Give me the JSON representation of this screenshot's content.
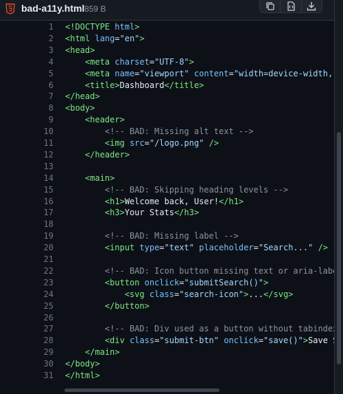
{
  "file": {
    "name": "bad-a11y.html",
    "size": "859 B",
    "icon": "html5-icon"
  },
  "actions": [
    {
      "name": "copy-button",
      "icon": "copy-icon"
    },
    {
      "name": "raw-button",
      "icon": "file-code-icon"
    },
    {
      "name": "download-button",
      "icon": "download-icon"
    }
  ],
  "colors": {
    "tag": "#7ee787",
    "attribute": "#79c0ff",
    "string": "#a5d6ff",
    "comment": "#8b949e",
    "text": "#e6edf3",
    "html5_icon": "#e34c26"
  },
  "code_lines": [
    {
      "n": "1",
      "indent": "",
      "tokens": [
        [
          "tag",
          "<!DOCTYPE"
        ],
        [
          "txt",
          " "
        ],
        [
          "attr",
          "html"
        ],
        [
          "tag",
          ">"
        ]
      ]
    },
    {
      "n": "2",
      "indent": "",
      "tokens": [
        [
          "tag",
          "<html"
        ],
        [
          "txt",
          " "
        ],
        [
          "attr",
          "lang"
        ],
        [
          "txt",
          "="
        ],
        [
          "str",
          "\"en\""
        ],
        [
          "tag",
          ">"
        ]
      ]
    },
    {
      "n": "3",
      "indent": "",
      "tokens": [
        [
          "tag",
          "<head>"
        ]
      ]
    },
    {
      "n": "4",
      "indent": "    ",
      "tokens": [
        [
          "tag",
          "<meta"
        ],
        [
          "txt",
          " "
        ],
        [
          "attr",
          "charset"
        ],
        [
          "txt",
          "="
        ],
        [
          "str",
          "\"UTF-8\""
        ],
        [
          "tag",
          ">"
        ]
      ]
    },
    {
      "n": "5",
      "indent": "    ",
      "tokens": [
        [
          "tag",
          "<meta"
        ],
        [
          "txt",
          " "
        ],
        [
          "attr",
          "name"
        ],
        [
          "txt",
          "="
        ],
        [
          "str",
          "\"viewport\""
        ],
        [
          "txt",
          " "
        ],
        [
          "attr",
          "content"
        ],
        [
          "txt",
          "="
        ],
        [
          "str",
          "\"width=device-width, i"
        ]
      ]
    },
    {
      "n": "6",
      "indent": "    ",
      "tokens": [
        [
          "tag",
          "<title>"
        ],
        [
          "txt",
          "Dashboard"
        ],
        [
          "tag",
          "</title>"
        ]
      ]
    },
    {
      "n": "7",
      "indent": "",
      "tokens": [
        [
          "tag",
          "</head>"
        ]
      ]
    },
    {
      "n": "8",
      "indent": "",
      "tokens": [
        [
          "tag",
          "<body>"
        ]
      ]
    },
    {
      "n": "9",
      "indent": "    ",
      "tokens": [
        [
          "tag",
          "<header>"
        ]
      ]
    },
    {
      "n": "10",
      "indent": "        ",
      "tokens": [
        [
          "com",
          "<!-- BAD: Missing alt text -->"
        ]
      ]
    },
    {
      "n": "11",
      "indent": "        ",
      "tokens": [
        [
          "tag",
          "<img"
        ],
        [
          "txt",
          " "
        ],
        [
          "attr",
          "src"
        ],
        [
          "txt",
          "="
        ],
        [
          "str",
          "\"/logo.png\""
        ],
        [
          "txt",
          " "
        ],
        [
          "tag",
          "/>"
        ]
      ]
    },
    {
      "n": "12",
      "indent": "    ",
      "tokens": [
        [
          "tag",
          "</header>"
        ]
      ]
    },
    {
      "n": "13",
      "indent": "",
      "tokens": []
    },
    {
      "n": "14",
      "indent": "    ",
      "tokens": [
        [
          "tag",
          "<main>"
        ]
      ]
    },
    {
      "n": "15",
      "indent": "        ",
      "tokens": [
        [
          "com",
          "<!-- BAD: Skipping heading levels -->"
        ]
      ]
    },
    {
      "n": "16",
      "indent": "        ",
      "tokens": [
        [
          "tag",
          "<h1>"
        ],
        [
          "txt",
          "Welcome back, User!"
        ],
        [
          "tag",
          "</h1>"
        ]
      ]
    },
    {
      "n": "17",
      "indent": "        ",
      "tokens": [
        [
          "tag",
          "<h3>"
        ],
        [
          "txt",
          "Your Stats"
        ],
        [
          "tag",
          "</h3>"
        ]
      ]
    },
    {
      "n": "18",
      "indent": "",
      "tokens": []
    },
    {
      "n": "19",
      "indent": "        ",
      "tokens": [
        [
          "com",
          "<!-- BAD: Missing label -->"
        ]
      ]
    },
    {
      "n": "20",
      "indent": "        ",
      "tokens": [
        [
          "tag",
          "<input"
        ],
        [
          "txt",
          " "
        ],
        [
          "attr",
          "type"
        ],
        [
          "txt",
          "="
        ],
        [
          "str",
          "\"text\""
        ],
        [
          "txt",
          " "
        ],
        [
          "attr",
          "placeholder"
        ],
        [
          "txt",
          "="
        ],
        [
          "str",
          "\"Search...\""
        ],
        [
          "txt",
          " "
        ],
        [
          "tag",
          "/>"
        ]
      ]
    },
    {
      "n": "21",
      "indent": "",
      "tokens": []
    },
    {
      "n": "22",
      "indent": "        ",
      "tokens": [
        [
          "com",
          "<!-- BAD: Icon button missing text or aria-label"
        ]
      ]
    },
    {
      "n": "23",
      "indent": "        ",
      "tokens": [
        [
          "tag",
          "<button"
        ],
        [
          "txt",
          " "
        ],
        [
          "attr",
          "onclick"
        ],
        [
          "txt",
          "="
        ],
        [
          "str",
          "\"submitSearch()\""
        ],
        [
          "tag",
          ">"
        ]
      ]
    },
    {
      "n": "24",
      "indent": "            ",
      "tokens": [
        [
          "tag",
          "<svg"
        ],
        [
          "txt",
          " "
        ],
        [
          "attr",
          "class"
        ],
        [
          "txt",
          "="
        ],
        [
          "str",
          "\"search-icon\""
        ],
        [
          "tag",
          ">"
        ],
        [
          "txt",
          "..."
        ],
        [
          "tag",
          "</svg>"
        ]
      ]
    },
    {
      "n": "25",
      "indent": "        ",
      "tokens": [
        [
          "tag",
          "</button>"
        ]
      ]
    },
    {
      "n": "26",
      "indent": "",
      "tokens": []
    },
    {
      "n": "27",
      "indent": "        ",
      "tokens": [
        [
          "com",
          "<!-- BAD: Div used as a button without tabindex"
        ]
      ]
    },
    {
      "n": "28",
      "indent": "        ",
      "tokens": [
        [
          "tag",
          "<div"
        ],
        [
          "txt",
          " "
        ],
        [
          "attr",
          "class"
        ],
        [
          "txt",
          "="
        ],
        [
          "str",
          "\"submit-btn\""
        ],
        [
          "txt",
          " "
        ],
        [
          "attr",
          "onclick"
        ],
        [
          "txt",
          "="
        ],
        [
          "str",
          "\"save()\""
        ],
        [
          "tag",
          ">"
        ],
        [
          "txt",
          "Save Se"
        ]
      ]
    },
    {
      "n": "29",
      "indent": "    ",
      "tokens": [
        [
          "tag",
          "</main>"
        ]
      ]
    },
    {
      "n": "30",
      "indent": "",
      "tokens": [
        [
          "tag",
          "</body>"
        ]
      ]
    },
    {
      "n": "31",
      "indent": "",
      "tokens": [
        [
          "tag",
          "</html>"
        ]
      ]
    }
  ]
}
